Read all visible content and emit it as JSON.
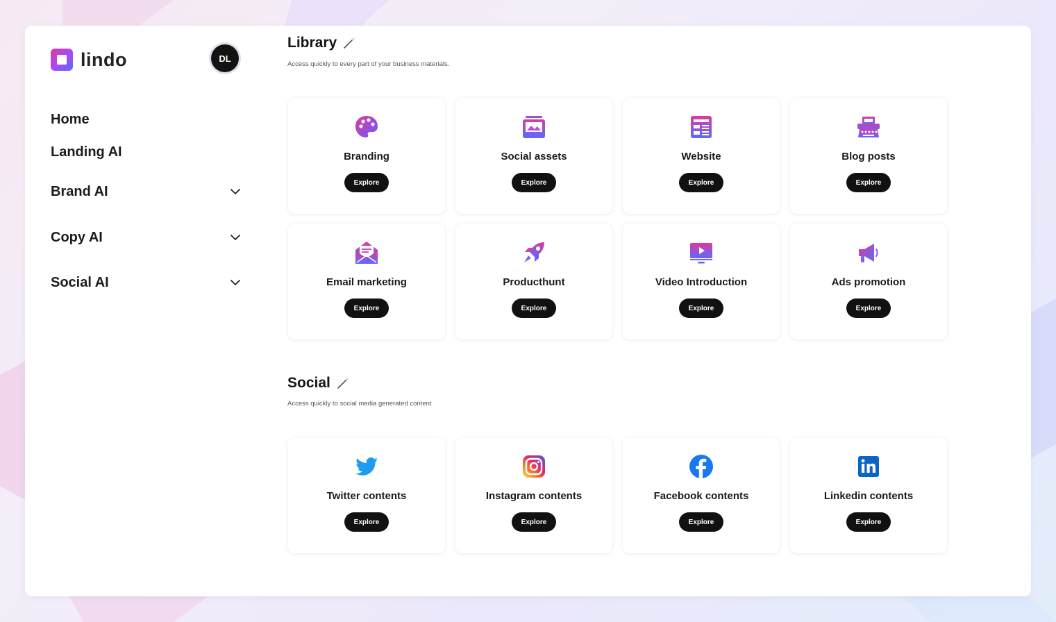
{
  "brand": {
    "name": "lindo"
  },
  "user": {
    "initials": "DL"
  },
  "nav": {
    "items": [
      {
        "label": "Home",
        "has_children": false
      },
      {
        "label": "Landing AI",
        "has_children": false
      },
      {
        "label": "Brand AI",
        "has_children": true
      },
      {
        "label": "Copy AI",
        "has_children": true
      },
      {
        "label": "Social AI",
        "has_children": true
      }
    ]
  },
  "library": {
    "title": "Library",
    "subtitle": "Access quickly to every part of your business materials.",
    "cards": [
      {
        "label": "Branding",
        "icon": "palette-icon",
        "button": "Explore"
      },
      {
        "label": "Social assets",
        "icon": "image-gallery-icon",
        "button": "Explore"
      },
      {
        "label": "Website",
        "icon": "webpage-layout-icon",
        "button": "Explore"
      },
      {
        "label": "Blog posts",
        "icon": "typewriter-icon",
        "button": "Explore"
      },
      {
        "label": "Email marketing",
        "icon": "open-envelope-icon",
        "button": "Explore"
      },
      {
        "label": "Producthunt",
        "icon": "rocket-icon",
        "button": "Explore"
      },
      {
        "label": "Video Introduction",
        "icon": "video-monitor-icon",
        "button": "Explore"
      },
      {
        "label": "Ads promotion",
        "icon": "megaphone-icon",
        "button": "Explore"
      }
    ]
  },
  "social": {
    "title": "Social",
    "subtitle": "Access quickly to social media generated content",
    "cards": [
      {
        "label": "Twitter contents",
        "icon": "twitter-icon",
        "button": "Explore"
      },
      {
        "label": "Instagram contents",
        "icon": "instagram-icon",
        "button": "Explore"
      },
      {
        "label": "Facebook contents",
        "icon": "facebook-icon",
        "button": "Explore"
      },
      {
        "label": "Linkedin contents",
        "icon": "linkedin-icon",
        "button": "Explore"
      }
    ]
  },
  "colors": {
    "accent_gradient_start": "#e0389f",
    "accent_gradient_end": "#5a6bff",
    "button_bg": "#111111",
    "twitter": "#1d9bf0",
    "facebook": "#1877f2",
    "linkedin": "#0a66c2"
  }
}
